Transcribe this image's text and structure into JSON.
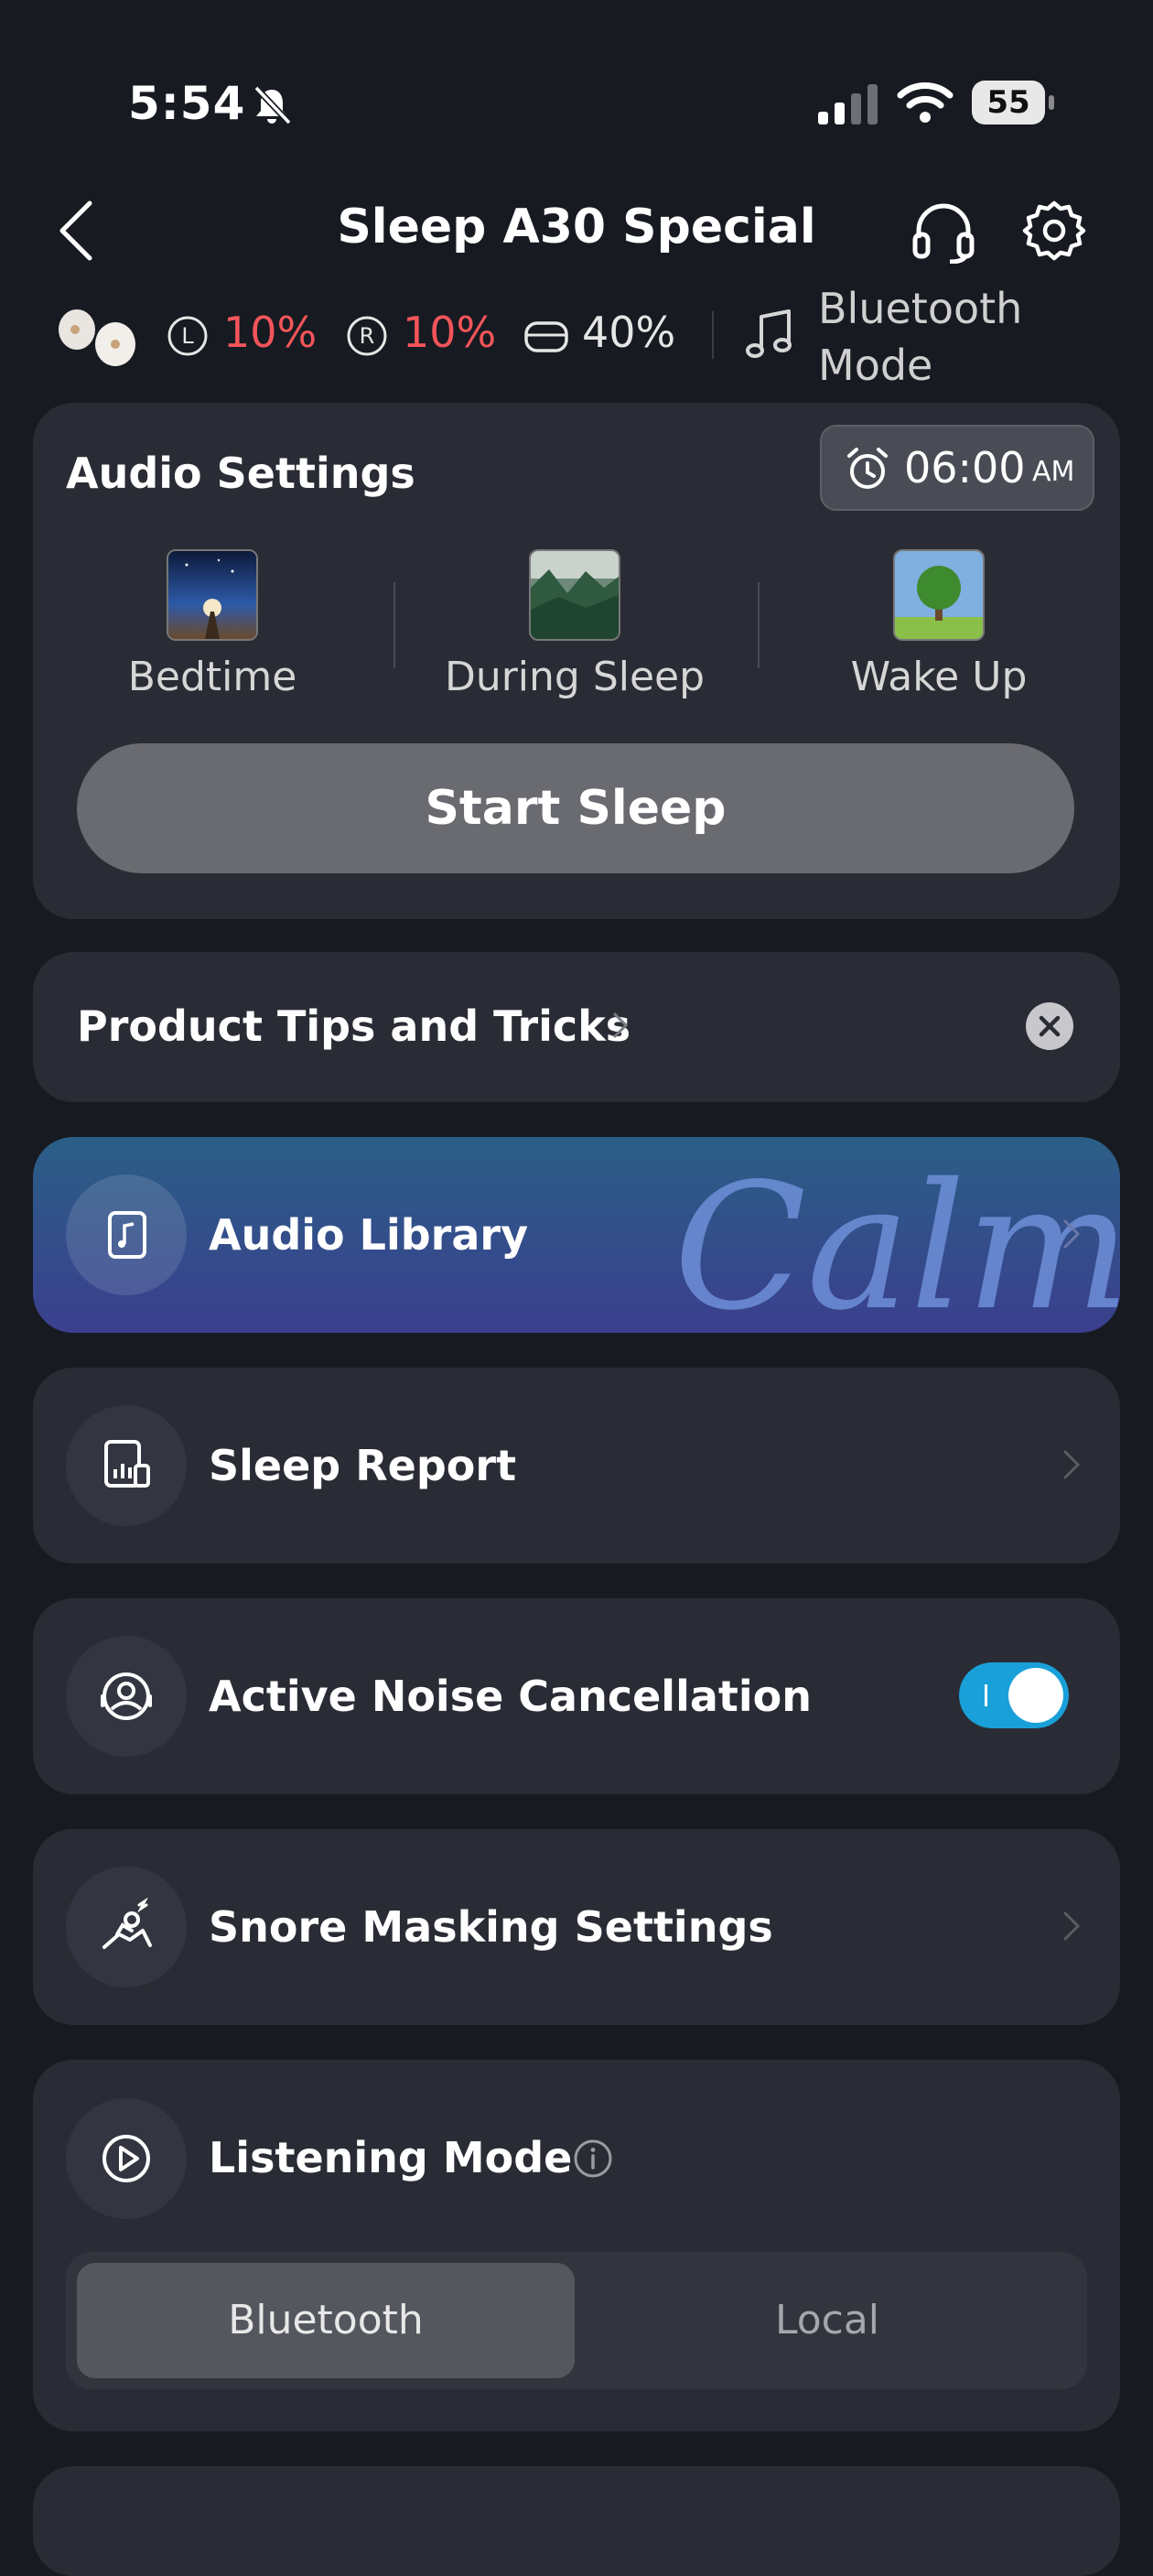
{
  "status_bar": {
    "time": "5:54",
    "battery": "55"
  },
  "header": {
    "title": "Sleep A30 Special"
  },
  "device": {
    "left_label": "L",
    "left_battery": "10%",
    "right_label": "R",
    "right_battery": "10%",
    "case_battery": "40%",
    "mode_line1": "Bluetooth",
    "mode_line2": "Mode"
  },
  "audio_settings": {
    "title": "Audio Settings",
    "alarm_time": "06:00",
    "alarm_ampm": "AM",
    "phases": [
      "Bedtime",
      "During Sleep",
      "Wake Up"
    ],
    "start_label": "Start Sleep"
  },
  "tips": {
    "label": "Product Tips and Tricks"
  },
  "library": {
    "label": "Audio Library",
    "brand": "Calm"
  },
  "report": {
    "label": "Sleep Report"
  },
  "anc": {
    "label": "Active Noise Cancellation",
    "enabled": true
  },
  "snore": {
    "label": "Snore Masking Settings"
  },
  "listening": {
    "label": "Listening Mode",
    "options": [
      "Bluetooth",
      "Local"
    ],
    "selected": "Bluetooth"
  },
  "colors": {
    "accent_toggle": "#1aa0d8",
    "battery_low": "#f2555a",
    "background": "#171a21",
    "card": "#2a2c35"
  }
}
